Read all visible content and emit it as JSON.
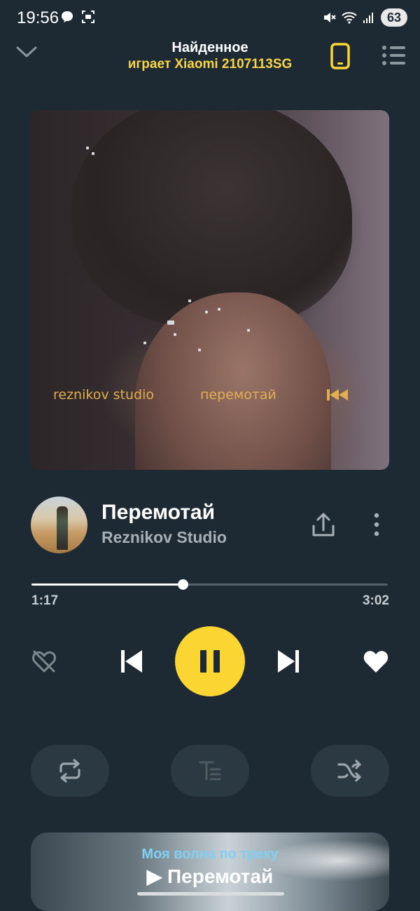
{
  "status_bar": {
    "time": "19:56",
    "battery": "63"
  },
  "header": {
    "title": "Найденное",
    "subtitle": "играет Xiaomi 2107113SG"
  },
  "cover": {
    "artist_text": "reznikov studio",
    "title_text": "перемотай",
    "icon": "rewind-icon"
  },
  "track": {
    "title": "Перемотай",
    "artist": "Reznikov Studio"
  },
  "progress": {
    "current": "1:17",
    "total": "3:02",
    "fraction": 0.425
  },
  "controls": {
    "state": "playing",
    "liked": true
  },
  "wave": {
    "subtitle": "Моя волна по треку",
    "title": "Перемотай"
  },
  "colors": {
    "background": "#1e2a33",
    "accent": "#fbd632",
    "subtitle_accent": "#f7d547",
    "wave_subtitle": "#7fd0f2"
  }
}
